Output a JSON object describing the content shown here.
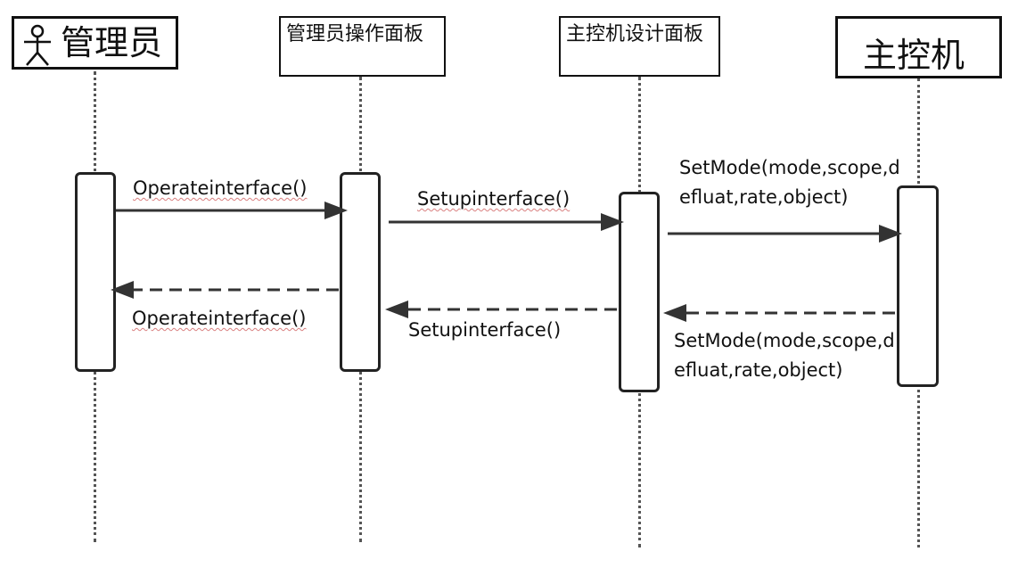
{
  "participants": {
    "admin": "管理员",
    "panel": "管理员操作面板",
    "design": "主控机设计面板",
    "host": "主控机"
  },
  "messages": {
    "m1": "Operateinterface()",
    "m2": "Setupinterface()",
    "m3": "SetMode(mode,scope,defluat,rate,object)",
    "r1": "Operateinterface()",
    "r2": "Setupinterface()",
    "r3": "SetMode(mode,scope,defluat,rate,object)"
  },
  "colors": {
    "line": "#333333",
    "squiggle": "#d98080"
  }
}
